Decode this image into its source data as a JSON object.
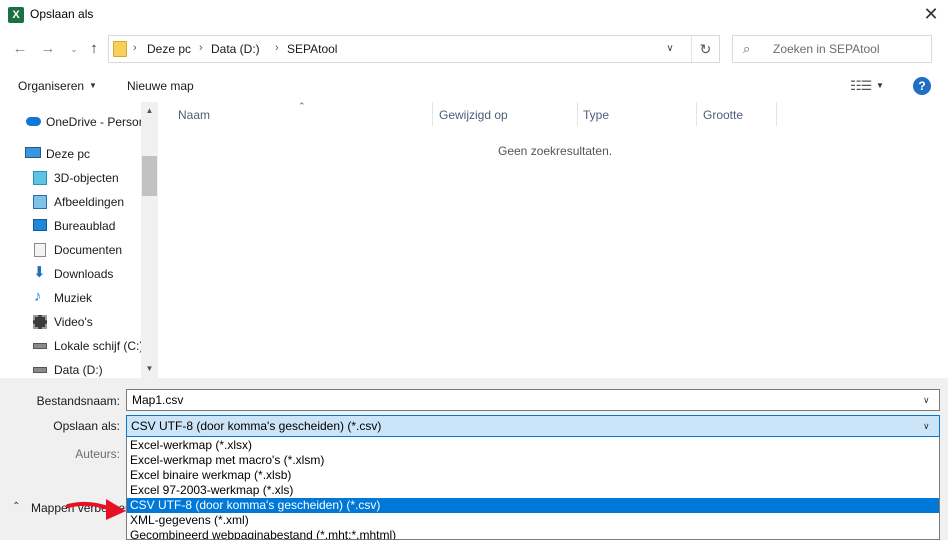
{
  "window": {
    "title": "Opslaan als",
    "app_icon": "excel-icon",
    "close_glyph": "✕"
  },
  "nav": {
    "back_icon": "arrow-left-icon",
    "forward_icon": "arrow-right-icon",
    "recent_icon": "chevron-down-icon",
    "up_icon": "arrow-up-icon",
    "breadcrumbs": [
      "Deze pc",
      "Data (D:)",
      "SEPAtool"
    ],
    "refresh_icon": "refresh-icon"
  },
  "search": {
    "placeholder": "Zoeken in SEPAtool"
  },
  "toolbar": {
    "organize_label": "Organiseren",
    "new_folder_label": "Nieuwe map"
  },
  "sidebar": {
    "items": [
      {
        "label": "OneDrive - Persor",
        "icon": "onedrive-icon"
      },
      {
        "label": "Deze pc",
        "icon": "computer-icon"
      },
      {
        "label": "3D-objecten",
        "icon": "3d-objects-icon"
      },
      {
        "label": "Afbeeldingen",
        "icon": "pictures-icon"
      },
      {
        "label": "Bureaublad",
        "icon": "desktop-icon"
      },
      {
        "label": "Documenten",
        "icon": "documents-icon"
      },
      {
        "label": "Downloads",
        "icon": "downloads-icon"
      },
      {
        "label": "Muziek",
        "icon": "music-icon"
      },
      {
        "label": "Video's",
        "icon": "videos-icon"
      },
      {
        "label": "Lokale schijf (C:)",
        "icon": "local-disk-icon"
      },
      {
        "label": "Data (D:)",
        "icon": "drive-icon"
      }
    ]
  },
  "filelist": {
    "columns": [
      "Naam",
      "Gewijzigd op",
      "Type",
      "Grootte"
    ],
    "empty_message": "Geen zoekresultaten."
  },
  "form": {
    "filename_label": "Bestandsnaam:",
    "filename_value": "Map1.csv",
    "type_label": "Opslaan als:",
    "type_value": "CSV UTF-8 (door komma's gescheiden) (*.csv)",
    "authors_label": "Auteurs:",
    "hide_folders_label": "Mappen verbergen"
  },
  "type_options": [
    "Excel-werkmap (*.xlsx)",
    "Excel-werkmap met macro's (*.xlsm)",
    "Excel binaire werkmap (*.xlsb)",
    "Excel 97-2003-werkmap (*.xls)",
    "CSV UTF-8 (door komma's gescheiden) (*.csv)",
    "XML-gegevens (*.xml)",
    "Gecombineerd webpaginabestand (*.mht;*.mhtml)"
  ],
  "selected_option_index": 4,
  "colors": {
    "accent": "#0078d7",
    "selection_bg": "#cce4f7",
    "annotation": "#e81123"
  }
}
